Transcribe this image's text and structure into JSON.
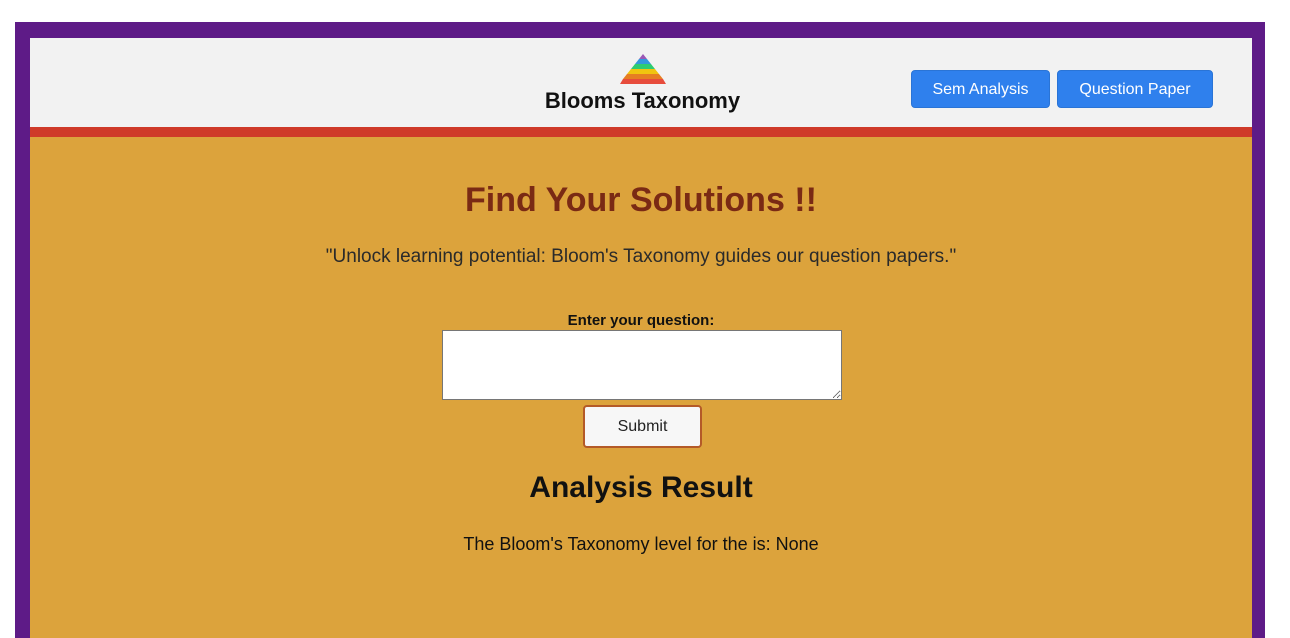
{
  "header": {
    "brand_title": "Blooms Taxonomy",
    "logo_icon": "pyramid-logo-icon",
    "nav": {
      "sem_analysis_label": "Sem Analysis",
      "question_paper_label": "Question Paper"
    }
  },
  "main": {
    "title": "Find Your Solutions !!",
    "tagline": "\"Unlock learning potential: Bloom's Taxonomy guides our question papers.\"",
    "question_label": "Enter your question:",
    "question_value": "",
    "submit_label": "Submit",
    "result_title": "Analysis Result",
    "result_text": "The Bloom's Taxonomy level for the is: None"
  },
  "colors": {
    "frame": "#5e1b87",
    "header_bg": "#f2f2f2",
    "header_stripe": "#cf3a29",
    "page_bg": "#dca33c",
    "title_color": "#7a2a14",
    "nav_button": "#2f80ed"
  }
}
